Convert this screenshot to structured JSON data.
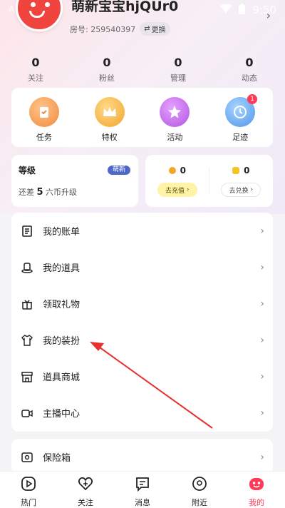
{
  "status": {
    "time": "9:50",
    "left_text": "A"
  },
  "profile": {
    "username": "萌新宝宝hjQUr0",
    "room_label": "房号: 259540397",
    "switch_label": "更换"
  },
  "stats": [
    {
      "value": "0",
      "label": "关注"
    },
    {
      "value": "0",
      "label": "粉丝"
    },
    {
      "value": "0",
      "label": "管理"
    },
    {
      "value": "0",
      "label": "动态"
    }
  ],
  "quick": [
    {
      "label": "任务",
      "icon": "task-icon",
      "color": "#f7a35c"
    },
    {
      "label": "特权",
      "icon": "crown-icon",
      "color": "#f7b43a"
    },
    {
      "label": "活动",
      "icon": "star-icon",
      "color": "#c26ae8"
    },
    {
      "label": "足迹",
      "icon": "clock-icon",
      "color": "#5fa8f0",
      "badge": "1"
    }
  ],
  "level": {
    "title": "等级",
    "badge": "萌新",
    "desc_prefix": "还差",
    "desc_value": "5",
    "desc_suffix": "六币升级"
  },
  "coins": [
    {
      "value": "0",
      "button": "去充值",
      "color": "#f4a623"
    },
    {
      "value": "0",
      "button": "去兑换",
      "color": "#f4c430"
    }
  ],
  "menu": [
    {
      "label": "我的账单",
      "icon": "bill-icon"
    },
    {
      "label": "我的道具",
      "icon": "prop-icon"
    },
    {
      "label": "领取礼物",
      "icon": "gift-icon"
    },
    {
      "label": "我的装扮",
      "icon": "tshirt-icon"
    },
    {
      "label": "道具商城",
      "icon": "shop-icon"
    },
    {
      "label": "主播中心",
      "icon": "camera-icon"
    }
  ],
  "menu2": [
    {
      "label": "保险箱",
      "icon": "safe-icon"
    }
  ],
  "tabs": [
    {
      "label": "热门",
      "icon": "play-icon"
    },
    {
      "label": "关注",
      "icon": "heart-plus-icon"
    },
    {
      "label": "消息",
      "icon": "message-icon"
    },
    {
      "label": "附近",
      "icon": "location-icon"
    },
    {
      "label": "我的",
      "icon": "me-icon",
      "active": true
    }
  ],
  "colors": {
    "accent": "#ff3a57",
    "annotation": "#e8312f"
  }
}
